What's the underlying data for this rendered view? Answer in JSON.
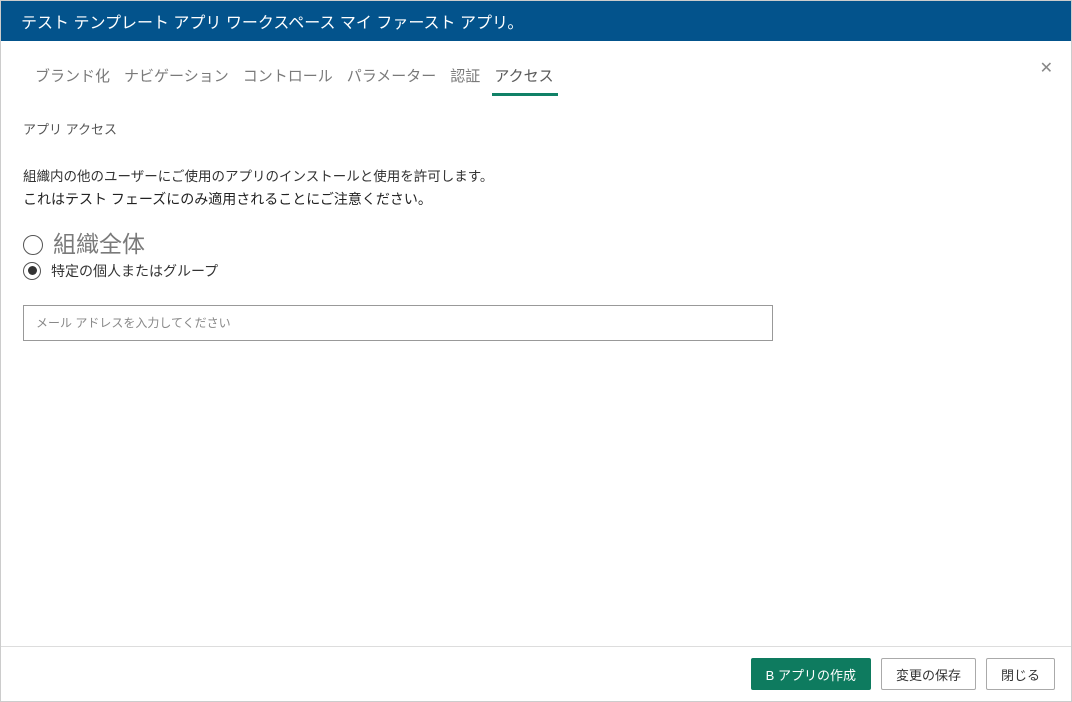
{
  "titleBar": {
    "text": "テスト テンプレート アプリ ワークスペース マイ ファースト アプリ。"
  },
  "tabs": {
    "items": [
      {
        "label": "ブランド化"
      },
      {
        "label": "ナビゲーション"
      },
      {
        "label": "コントロール"
      },
      {
        "label": "パラメーター"
      },
      {
        "label": "認証"
      },
      {
        "label": "アクセス"
      }
    ],
    "activeIndex": 5
  },
  "content": {
    "sectionTitle": "アプリ アクセス",
    "descLine1": "組織内の他のユーザーにご使用のアプリのインストールと使用を許可します。",
    "descLine2": "これはテスト フェーズにのみ適用されることにご注意ください。",
    "radio1Label": "組織全体",
    "radio2Label": "特定の個人またはグループ",
    "selectedRadio": 2,
    "emailPlaceholder": "メール アドレスを入力してください"
  },
  "footer": {
    "createButton": "B アプリの作成",
    "saveButton": "変更の保存",
    "closeButton": "閉じる"
  }
}
